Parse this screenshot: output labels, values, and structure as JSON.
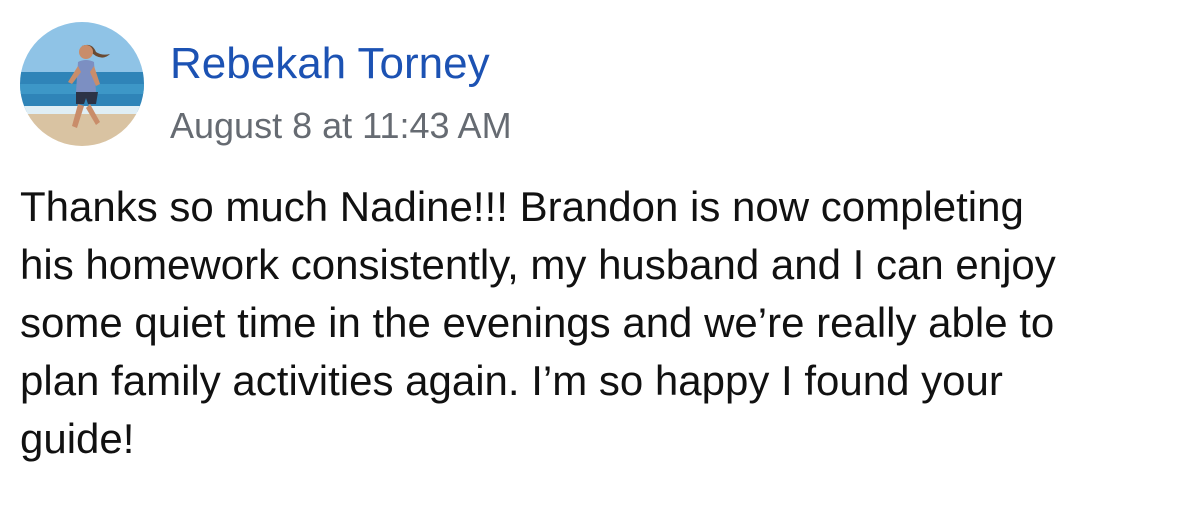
{
  "post": {
    "author_name": "Rebekah Torney",
    "timestamp": "August 8 at 11:43 AM",
    "avatar_icon": "profile-photo",
    "body_lines": [
      "Thanks so much Nadine!!! Brandon is now completing",
      "his homework consistently, my husband and I can enjoy",
      "some quiet time in the evenings and we’re really able to",
      "plan family activities again. I’m so happy I found your",
      "guide!"
    ]
  },
  "colors": {
    "author_link": "#1c52b3",
    "timestamp": "#666b72",
    "body_text": "#111111",
    "background": "#ffffff"
  }
}
